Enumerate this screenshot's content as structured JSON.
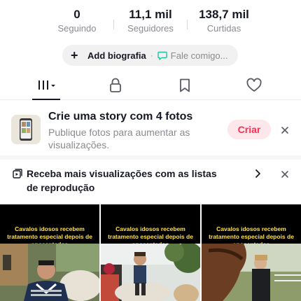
{
  "stats": [
    {
      "value": "0",
      "label": "Seguindo"
    },
    {
      "value": "11,1 mil",
      "label": "Seguidores"
    },
    {
      "value": "138,7 mil",
      "label": "Curtidas"
    }
  ],
  "bio": {
    "add_label": "Add biografia",
    "separator": "·",
    "chat_label": "Fale comigo..."
  },
  "tabs": [
    {
      "icon": "videos-grid-icon",
      "active": true
    },
    {
      "icon": "lock-icon",
      "active": false
    },
    {
      "icon": "bookmark-icon",
      "active": false
    },
    {
      "icon": "heart-icon",
      "active": false
    }
  ],
  "story": {
    "title": "Crie uma story com 4 fotos",
    "subtitle": "Publique fotos para aumentar as visualizações.",
    "button": "Criar"
  },
  "playlist": {
    "text": "Receba mais visualizações com as listas de reprodução"
  },
  "videos": [
    {
      "caption": "Cavalos idosos recebem tratamento especial depois de aposentados"
    },
    {
      "caption": "Cavalos idosos recebem tratamento especial depois de aposentados"
    },
    {
      "caption": "Cavalos idosos recebem tratamento especial depois de aposentados"
    }
  ],
  "colors": {
    "accent": "#fe2c55",
    "text": "#161823",
    "muted": "#8a8b91",
    "caption": "#ffe14a"
  }
}
